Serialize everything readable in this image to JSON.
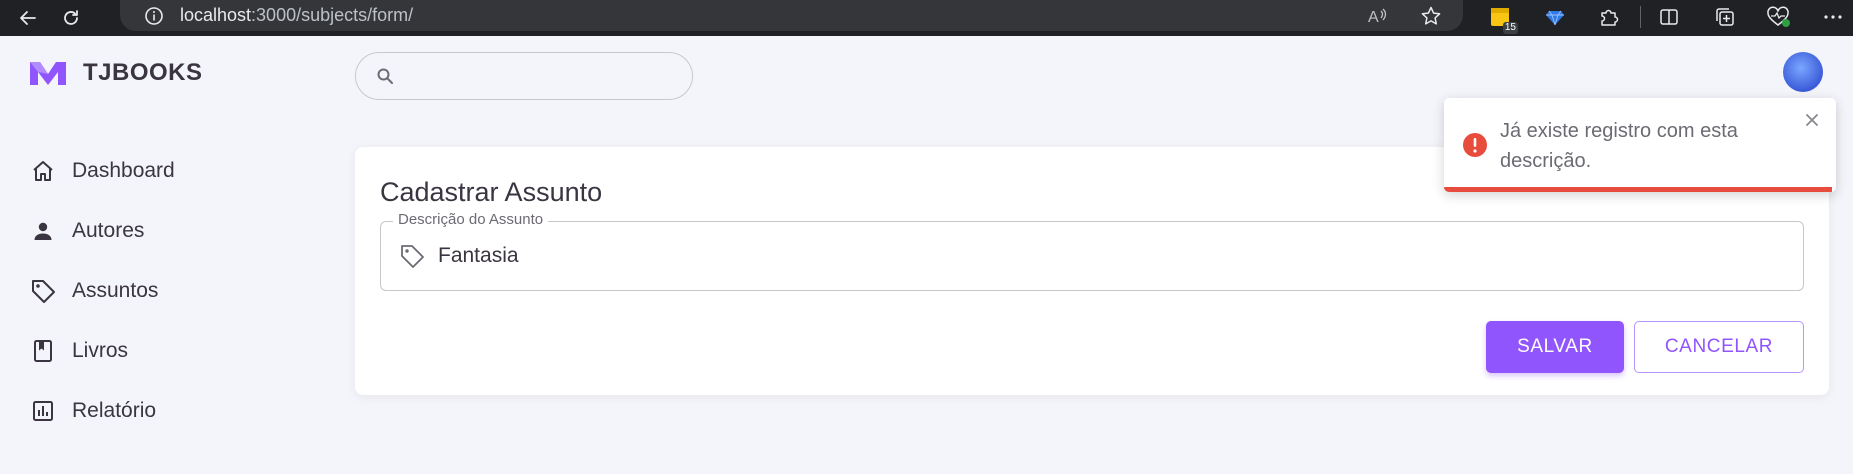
{
  "browser": {
    "url_host": "localhost",
    "url_path": ":3000/subjects/form/",
    "extension_badge": "15",
    "icons": [
      "back-arrow-icon",
      "refresh-icon",
      "info-icon",
      "read-aloud-icon",
      "favorite-star-icon",
      "sticky-notes-extension-icon",
      "diamond-extension-icon",
      "puzzle-extensions-icon",
      "split-screen-icon",
      "collections-icon",
      "browser-health-icon",
      "more-menu-icon"
    ]
  },
  "brand": {
    "name": "TJBOOKS",
    "logo_color": "#9155fd"
  },
  "search": {
    "placeholder": "",
    "value": ""
  },
  "sidebar": {
    "items": [
      {
        "label": "Dashboard",
        "icon": "home-icon"
      },
      {
        "label": "Autores",
        "icon": "person-icon"
      },
      {
        "label": "Assuntos",
        "icon": "tag-icon"
      },
      {
        "label": "Livros",
        "icon": "book-icon"
      },
      {
        "label": "Relatório",
        "icon": "report-chart-icon"
      }
    ]
  },
  "form": {
    "title": "Cadastrar Assunto",
    "description_label": "Descrição do Assunto",
    "description_value": "Fantasia",
    "save_label": "SALVAR",
    "cancel_label": "CANCELAR"
  },
  "toast": {
    "message": "Já existe registro com esta descrição.",
    "type": "error",
    "progress": 0.99,
    "color": "#e74c3c"
  },
  "colors": {
    "primary": "#9155fd",
    "background": "#f4f5fa",
    "text": "#3a3541",
    "error": "#e74c3c"
  }
}
